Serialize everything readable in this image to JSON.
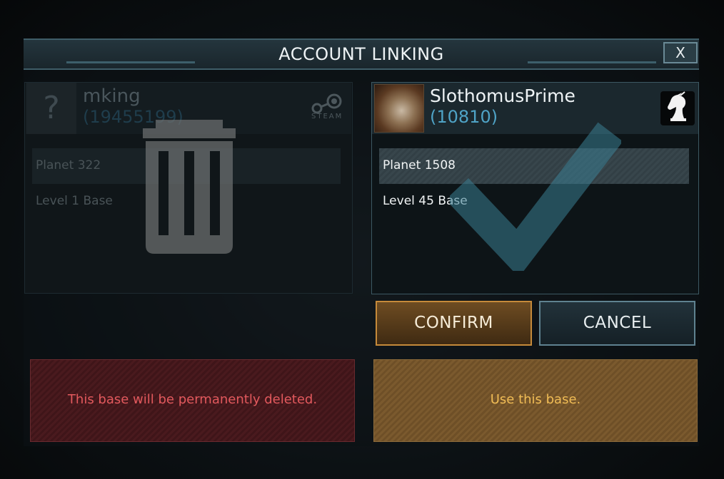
{
  "dialog": {
    "title": "ACCOUNT LINKING",
    "close_label": "X"
  },
  "left_account": {
    "avatar_placeholder": "?",
    "name": "mking",
    "id": "(19455199)",
    "platform_label": "STEAM",
    "platform_icon": "steam-icon",
    "planet": "Planet 322",
    "level": "Level 1 Base",
    "overlay_icon": "trash-icon",
    "info": "This base will be permanently deleted."
  },
  "right_account": {
    "name": "SlothomusPrime",
    "id": "(10810)",
    "platform_icon": "knight-icon",
    "planet": "Planet 1508",
    "level": "Level 45 Base",
    "overlay_icon": "check-icon",
    "info": "Use this base."
  },
  "buttons": {
    "confirm": "CONFIRM",
    "cancel": "CANCEL"
  },
  "colors": {
    "accent_blue": "#4fa3c6",
    "confirm_border": "#c68a3a",
    "delete_text": "#e2595d",
    "use_text": "#f0bc55"
  }
}
